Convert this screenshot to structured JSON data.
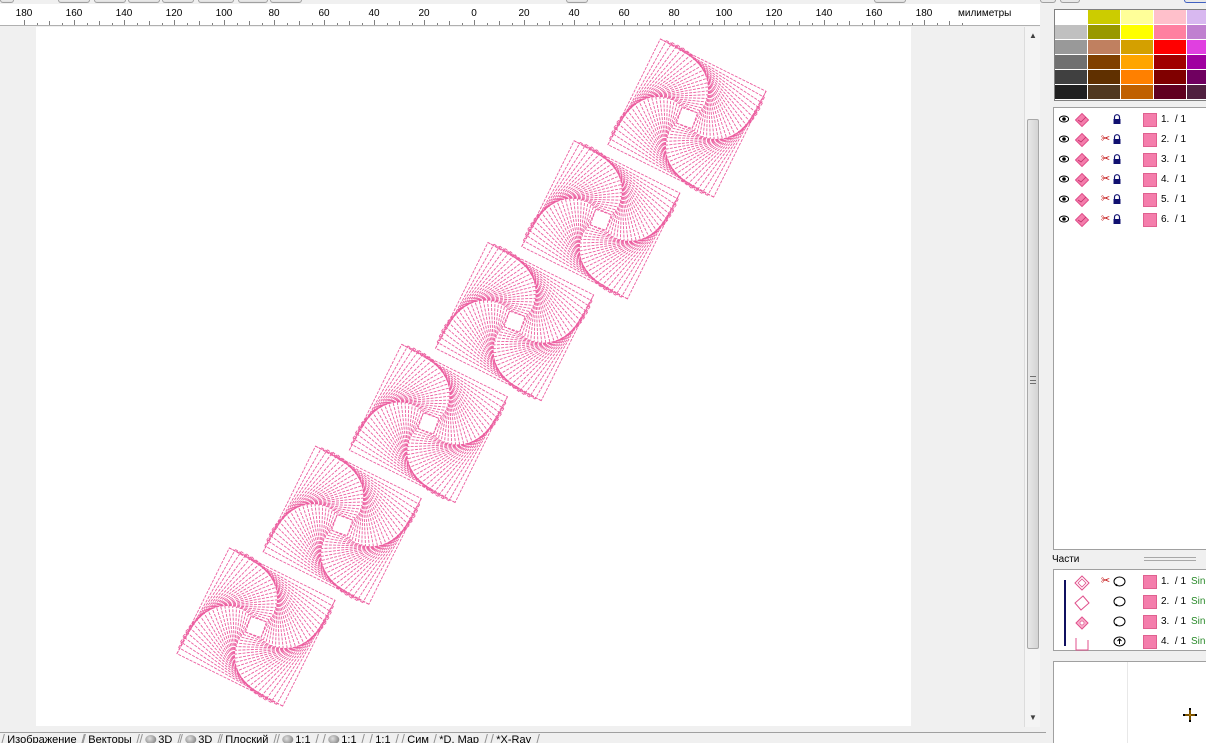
{
  "ruler": {
    "unit": "милиметры",
    "ticks": [
      "180",
      "160",
      "140",
      "120",
      "100",
      "80",
      "60",
      "40",
      "20",
      "0",
      "20",
      "40",
      "60",
      "80",
      "100",
      "120",
      "140",
      "160",
      "180"
    ]
  },
  "objects": [
    {
      "label": "1.  / 1",
      "has_scissors": false,
      "color": "#f47eac"
    },
    {
      "label": "2.  / 1",
      "has_scissors": true,
      "color": "#f47eac"
    },
    {
      "label": "3.  / 1",
      "has_scissors": true,
      "color": "#f47eac"
    },
    {
      "label": "4.  / 1",
      "has_scissors": true,
      "color": "#f47eac"
    },
    {
      "label": "5.  / 1",
      "has_scissors": true,
      "color": "#f47eac"
    },
    {
      "label": "6.  / 1",
      "has_scissors": true,
      "color": "#f47eac"
    }
  ],
  "parts": {
    "title": "Части",
    "items": [
      {
        "label": "1.  / 1",
        "fill": "Sing",
        "has_scissors": true
      },
      {
        "label": "2.  / 1",
        "fill": "Sing",
        "has_scissors": false
      },
      {
        "label": "3.  / 1",
        "fill": "Sing",
        "has_scissors": false
      },
      {
        "label": "4.  / 1",
        "fill": "Sing",
        "has_scissors": false
      }
    ]
  },
  "tabs": [
    {
      "label": "Изображение",
      "icon": false
    },
    {
      "label": "Векторы",
      "icon": false
    },
    {
      "label": "3D",
      "icon": true
    },
    {
      "label": "3D",
      "icon": true
    },
    {
      "label": "Плоский",
      "icon": false
    },
    {
      "label": "1:1",
      "icon": true
    },
    {
      "label": "1:1",
      "icon": true
    },
    {
      "label": "1:1",
      "icon": false
    },
    {
      "label": "Сим",
      "icon": false
    },
    {
      "label": "*D. Map",
      "icon": false
    },
    {
      "label": "*X-Ray",
      "icon": false
    }
  ],
  "palette": {
    "colors": [
      [
        "#ffffff",
        "#cccc00",
        "#ffff99",
        "#ffc0cb",
        "#d8b8f0"
      ],
      [
        "#c0c0c0",
        "#999900",
        "#ffff00",
        "#ff80a0",
        "#c080d0"
      ],
      [
        "#999999",
        "#c08060",
        "#d4a000",
        "#ff0000",
        "#e040e0"
      ],
      [
        "#707070",
        "#804000",
        "#ffa500",
        "#a00000",
        "#a000a0"
      ],
      [
        "#404040",
        "#603000",
        "#ff8000",
        "#800000",
        "#700060"
      ],
      [
        "#202020",
        "#503820",
        "#c06000",
        "#600020",
        "#502040"
      ]
    ]
  },
  "design": {
    "thread_color": "#ec5fa0",
    "motif_count": 6
  },
  "icons": {
    "visibility": "eye-icon",
    "lock": "lock-icon",
    "scissors": "scissors-icon",
    "preview": "crosshair-icon"
  }
}
